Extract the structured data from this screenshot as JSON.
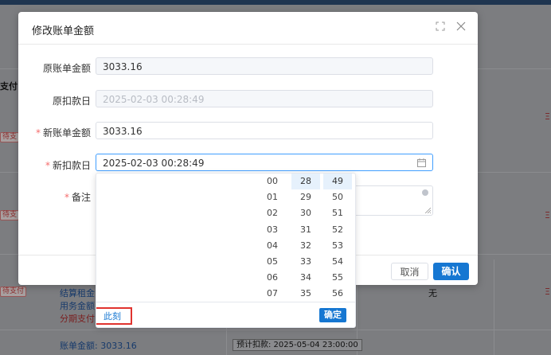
{
  "background": {
    "pay_column_header": "支付",
    "status_pending": "待支",
    "status_pending_full": "待支付",
    "settlement_rent": "结算租金:",
    "service_fee": "用务金额:",
    "installment_pay": "分期支付",
    "bill_amount": "账单金额: 3033.16",
    "none_text": "无",
    "expected_deduction": "预计扣款: 2025-05-04 23:00:00",
    "right_mark": "Ξ"
  },
  "dialog": {
    "title": "修改账单金额",
    "fields": [
      {
        "label": "原账单金额",
        "value": "3033.16",
        "required": false
      },
      {
        "label": "原扣款日",
        "value": "2025-02-03 00:28:49",
        "required": false
      },
      {
        "label": "新账单金额",
        "value": "3033.16",
        "required": true
      },
      {
        "label": "新扣款日",
        "value": "2025-02-03 00:28:49",
        "required": true
      },
      {
        "label": "备注",
        "value": "",
        "required": true
      }
    ],
    "cancel_label": "取消",
    "confirm_label": "确认"
  },
  "picker": {
    "hours": [
      "00",
      "01",
      "02",
      "03",
      "04",
      "05",
      "06",
      "07"
    ],
    "minutes": [
      "28",
      "29",
      "30",
      "31",
      "32",
      "33",
      "34",
      "35"
    ],
    "seconds": [
      "49",
      "50",
      "51",
      "52",
      "53",
      "54",
      "55",
      "56"
    ],
    "selected_hour": "00",
    "selected_minute": "28",
    "selected_second": "49",
    "now_label": "此刻",
    "ok_label": "确定"
  },
  "colors": {
    "primary": "#1677d2",
    "required": "#f56c6c",
    "highlight": "#e0332f"
  }
}
